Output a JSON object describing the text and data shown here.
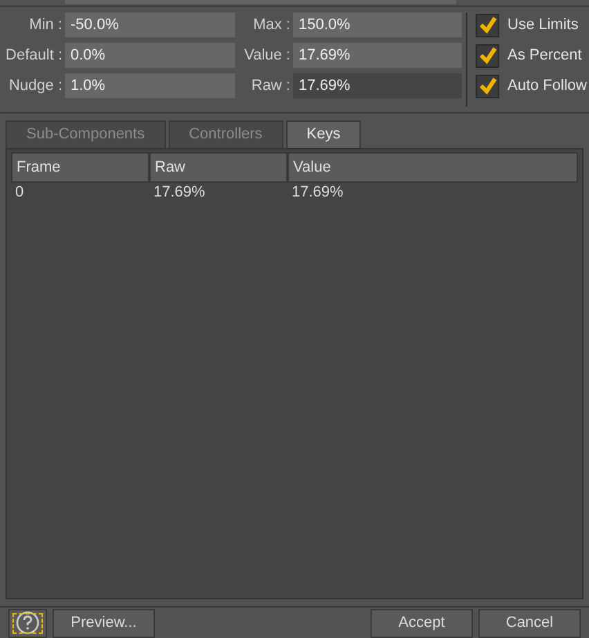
{
  "fields": [
    {
      "label": "Min :",
      "value": "-50.0%",
      "editable": true
    },
    {
      "label": "Max :",
      "value": "150.0%",
      "editable": true
    },
    {
      "label": "Default :",
      "value": "0.0%",
      "editable": true
    },
    {
      "label": "Value :",
      "value": "17.69%",
      "editable": true
    },
    {
      "label": "Nudge :",
      "value": "1.0%",
      "editable": true
    },
    {
      "label": "Raw :",
      "value": "17.69%",
      "editable": false
    }
  ],
  "options": [
    {
      "label": "Use Limits",
      "checked": true
    },
    {
      "label": "As Percent",
      "checked": true
    },
    {
      "label": "Auto Follow",
      "checked": true
    }
  ],
  "tabs": [
    {
      "label": "Sub-Components",
      "selected": false
    },
    {
      "label": "Controllers",
      "selected": false
    },
    {
      "label": "Keys",
      "selected": true
    }
  ],
  "table": {
    "columns": [
      "Frame",
      "Raw",
      "Value"
    ],
    "rows": [
      [
        "0",
        "17.69%",
        "17.69%"
      ]
    ]
  },
  "buttons": {
    "left": [
      "Preview..."
    ],
    "right": [
      "Accept",
      "Cancel"
    ]
  }
}
